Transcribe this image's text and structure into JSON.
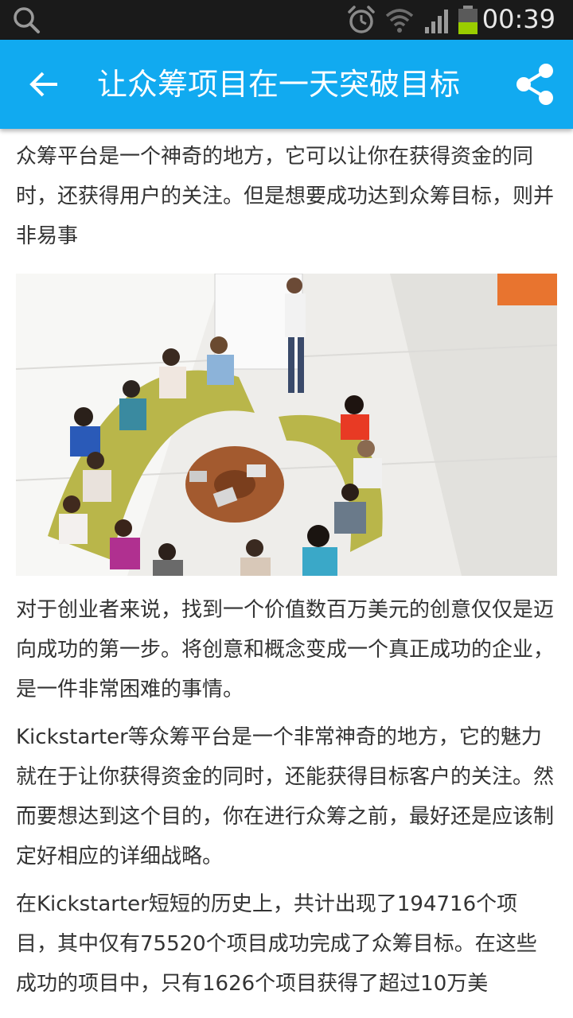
{
  "status_bar": {
    "time": "00:39",
    "icons": [
      "search-icon",
      "alarm-icon",
      "wifi-icon",
      "signal-icon",
      "battery-icon"
    ]
  },
  "app_bar": {
    "title": "让众筹项目在一天突破目标",
    "back_icon": "arrow-left-icon",
    "share_icon": "share-icon",
    "color": "#11aaf0"
  },
  "article": {
    "intro": "众筹平台是一个神奇的地方，它可以让你在获得资金的同时，还获得用户的关注。但是想要成功达到众筹目标，则并非易事",
    "image": "meeting-photo",
    "paragraphs": [
      "对于创业者来说，找到一个价值数百万美元的创意仅仅是迈向成功的第一步。将创意和概念变成一个真正成功的企业，是一件非常困难的事情。",
      "Kickstarter等众筹平台是一个非常神奇的地方，它的魅力就在于让你获得资金的同时，还能获得目标客户的关注。然而要想达到这个目的，你在进行众筹之前，最好还是应该制定好相应的详细战略。",
      "在Kickstarter短短的历史上，共计出现了194716个项目，其中仅有75520个项目成功完成了众筹目标。在这些成功的项目中，只有1626个项目获得了超过10万美"
    ]
  }
}
